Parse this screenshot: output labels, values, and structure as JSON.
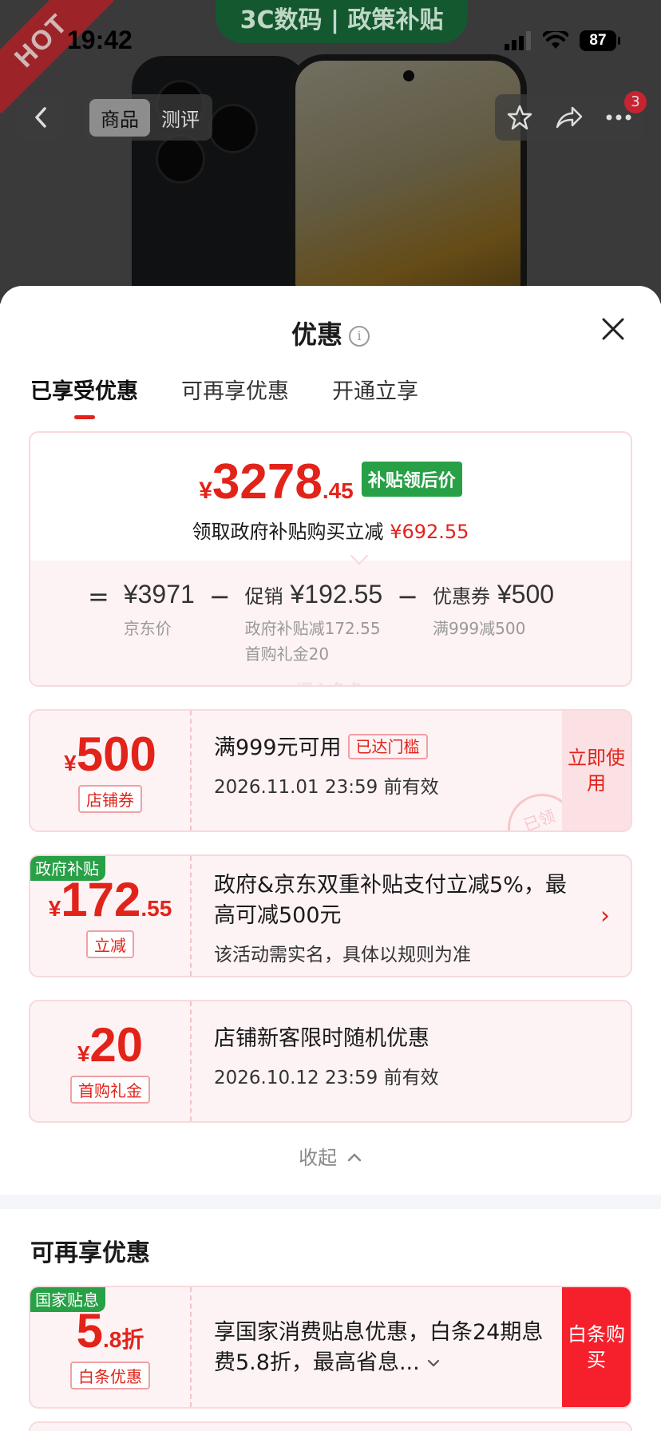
{
  "status_bar": {
    "time": "19:42",
    "battery": "87"
  },
  "product_header": {
    "hot_label": "HOT",
    "banner": "3C数码 | 政策补贴",
    "tabs": [
      "商品",
      "测评"
    ],
    "notification_count": "3"
  },
  "sheet": {
    "title": "优惠",
    "tabs": [
      "已享受优惠",
      "可再享优惠",
      "开通立享"
    ],
    "summary": {
      "currency": "¥",
      "price_int": "3278",
      "price_dec": ".45",
      "price_tag": "补贴领后价",
      "desc": "领取政府补贴购买立减",
      "desc_amount": "¥692.55",
      "breakdown": {
        "equals": "=",
        "minus": "−",
        "jd_price": "¥3971",
        "jd_price_label": "京东价",
        "promo_label": "促销",
        "promo_value": "¥192.55",
        "promo_sub1": "政府补贴减172.55",
        "promo_sub2": "首购礼金20",
        "coupon_label": "优惠券",
        "coupon_value": "¥500",
        "coupon_sub": "满999减500"
      },
      "watermark": "樱心兔兔"
    },
    "coupons": [
      {
        "currency": "¥",
        "amount": "500",
        "decimal": "",
        "type_label": "店铺券",
        "title": "满999元可用",
        "badge": "已达门槛",
        "validity": "2026.11.01 23:59 前有效",
        "action": "立即使用",
        "stamp": "已领"
      },
      {
        "corner": "政府补贴",
        "currency": "¥",
        "amount": "172",
        "decimal": ".55",
        "type_label": "立减",
        "title": "政府&京东双重补贴支付立减5%，最高可减500元",
        "sub": "该活动需实名，具体以规则为准"
      },
      {
        "currency": "¥",
        "amount": "20",
        "decimal": "",
        "type_label": "首购礼金",
        "title": "店铺新客限时随机优惠",
        "validity": "2026.10.12 23:59 前有效"
      }
    ],
    "collapse_label": "收起",
    "more_section": {
      "title": "可再享优惠",
      "offer": {
        "corner": "国家贴息",
        "amount": "5",
        "decimal": ".8折",
        "type_label": "白条优惠",
        "title": "享国家消费贴息优惠，白条24期息费5.8折，最高省息...",
        "action": "白条购买"
      }
    }
  },
  "colors": {
    "accent_red": "#e2231a",
    "green": "#27a046",
    "card_bg": "#fdf3f4"
  }
}
